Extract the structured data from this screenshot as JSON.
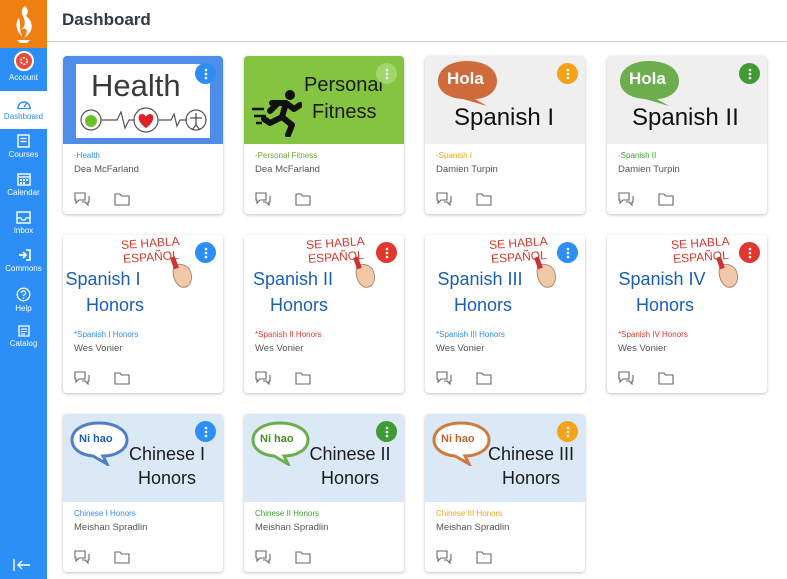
{
  "page": {
    "title": "Dashboard"
  },
  "sidebar": {
    "items": [
      {
        "label": "Account",
        "icon": "account-icon"
      },
      {
        "label": "Dashboard",
        "icon": "dashboard-icon"
      },
      {
        "label": "Courses",
        "icon": "courses-icon"
      },
      {
        "label": "Calendar",
        "icon": "calendar-icon"
      },
      {
        "label": "Inbox",
        "icon": "inbox-icon"
      },
      {
        "label": "Commons",
        "icon": "commons-icon"
      },
      {
        "label": "Help",
        "icon": "help-icon"
      },
      {
        "label": "Catalog",
        "icon": "catalog-icon"
      }
    ],
    "active": "Dashboard",
    "colors": {
      "bg": "#2d8ef5",
      "logo_bg": "#f07f12"
    }
  },
  "cards": [
    {
      "code": "-Health",
      "teacher": "Dea McFarland",
      "color": "#2d8ef5",
      "hero_text": "Health"
    },
    {
      "code": "-Personal Fitness",
      "teacher": "Dea McFarland",
      "color": "#84c440",
      "hero_line1": "Personal",
      "hero_line2": "Fitness"
    },
    {
      "code": "-Spanish I",
      "teacher": "Damien Turpin",
      "color": "#f2a31b",
      "bubble": "Hola",
      "hero_text": "Spanish I"
    },
    {
      "code": "-Spanish II",
      "teacher": "Damien Turpin",
      "color": "#3f9c35",
      "bubble": "Hola",
      "hero_text": "Spanish II"
    },
    {
      "code": "*Spanish I Honors",
      "teacher": "Wes Vonier",
      "color": "#2d8ef5",
      "banner1": "SE HABLA",
      "banner2": "ESPAÑOL",
      "hero_line1": "Spanish I",
      "hero_line2": "Honors"
    },
    {
      "code": "*Spanish II Honors",
      "teacher": "Wes Vonier",
      "color": "#e0382e",
      "banner1": "SE HABLA",
      "banner2": "ESPAÑOL",
      "hero_line1": "Spanish II",
      "hero_line2": "Honors"
    },
    {
      "code": "*Spanish III Honors",
      "teacher": "Wes Vonier",
      "color": "#2d8ef5",
      "banner1": "SE HABLA",
      "banner2": "ESPAÑOL",
      "hero_line1": "Spanish III",
      "hero_line2": "Honors"
    },
    {
      "code": "*Spanish IV Honors",
      "teacher": "Wes Vonier",
      "color": "#e0382e",
      "banner1": "SE HABLA",
      "banner2": "ESPAÑOL",
      "hero_line1": "Spanish IV",
      "hero_line2": "Honors"
    },
    {
      "code": "Chinese I Honors",
      "teacher": "Meishan Spradlin",
      "color": "#2d8ef5",
      "bubble": "Ni hao",
      "hero_line1": "Chinese I",
      "hero_line2": "Honors"
    },
    {
      "code": "Chinese II Honors",
      "teacher": "Meishan Spradlin",
      "color": "#3f9c35",
      "bubble": "Ni hao",
      "hero_line1": "Chinese II",
      "hero_line2": "Honors"
    },
    {
      "code": "Chinese III Honors",
      "teacher": "Meishan Spradlin",
      "color": "#f2a31b",
      "bubble": "Ni hao",
      "hero_line1": "Chinese III",
      "hero_line2": "Honors"
    }
  ]
}
